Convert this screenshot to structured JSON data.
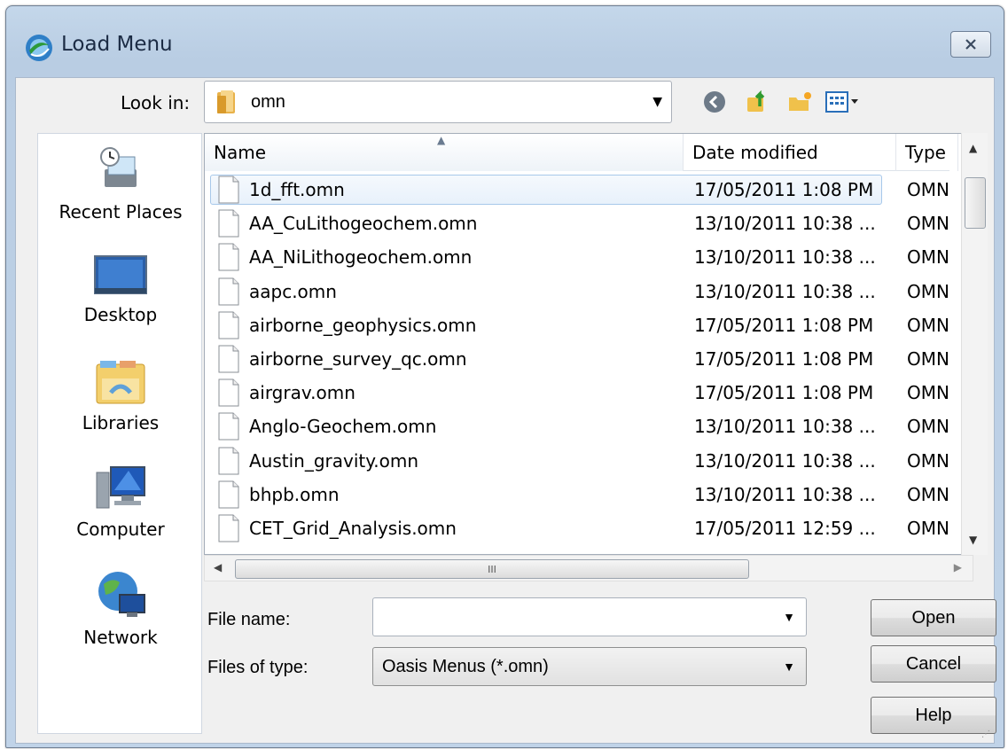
{
  "window": {
    "title": "Load Menu"
  },
  "look_in": {
    "label": "Look in:",
    "value": "omn"
  },
  "places": [
    {
      "label": "Recent Places",
      "icon": "recent-places-icon"
    },
    {
      "label": "Desktop",
      "icon": "desktop-icon"
    },
    {
      "label": "Libraries",
      "icon": "libraries-icon"
    },
    {
      "label": "Computer",
      "icon": "computer-icon"
    },
    {
      "label": "Network",
      "icon": "network-icon"
    }
  ],
  "columns": {
    "name": "Name",
    "date": "Date modified",
    "type": "Type"
  },
  "files": [
    {
      "name": "1d_fft.omn",
      "date": "17/05/2011 1:08 PM",
      "type": "OMN F"
    },
    {
      "name": "AA_CuLithogeochem.omn",
      "date": "13/10/2011 10:38 ...",
      "type": "OMN F"
    },
    {
      "name": "AA_NiLithogeochem.omn",
      "date": "13/10/2011 10:38 ...",
      "type": "OMN F"
    },
    {
      "name": "aapc.omn",
      "date": "13/10/2011 10:38 ...",
      "type": "OMN F"
    },
    {
      "name": "airborne_geophysics.omn",
      "date": "17/05/2011 1:08 PM",
      "type": "OMN F"
    },
    {
      "name": "airborne_survey_qc.omn",
      "date": "17/05/2011 1:08 PM",
      "type": "OMN F"
    },
    {
      "name": "airgrav.omn",
      "date": "17/05/2011 1:08 PM",
      "type": "OMN F"
    },
    {
      "name": "Anglo-Geochem.omn",
      "date": "13/10/2011 10:38 ...",
      "type": "OMN F"
    },
    {
      "name": "Austin_gravity.omn",
      "date": "13/10/2011 10:38 ...",
      "type": "OMN F"
    },
    {
      "name": "bhpb.omn",
      "date": "13/10/2011 10:38 ...",
      "type": "OMN F"
    },
    {
      "name": "CET_Grid_Analysis.omn",
      "date": "17/05/2011 12:59 ...",
      "type": "OMN F"
    }
  ],
  "file_name": {
    "label": "File name:",
    "value": ""
  },
  "file_type": {
    "label": "Files of type:",
    "value": "Oasis Menus (*.omn)"
  },
  "buttons": {
    "open": "Open",
    "cancel": "Cancel",
    "help": "Help"
  },
  "scroll_thumb_label": "III",
  "colors": {
    "titlebar": "#b9cde3",
    "selection": "#e8f1fb",
    "panel": "#f0f0f0"
  }
}
